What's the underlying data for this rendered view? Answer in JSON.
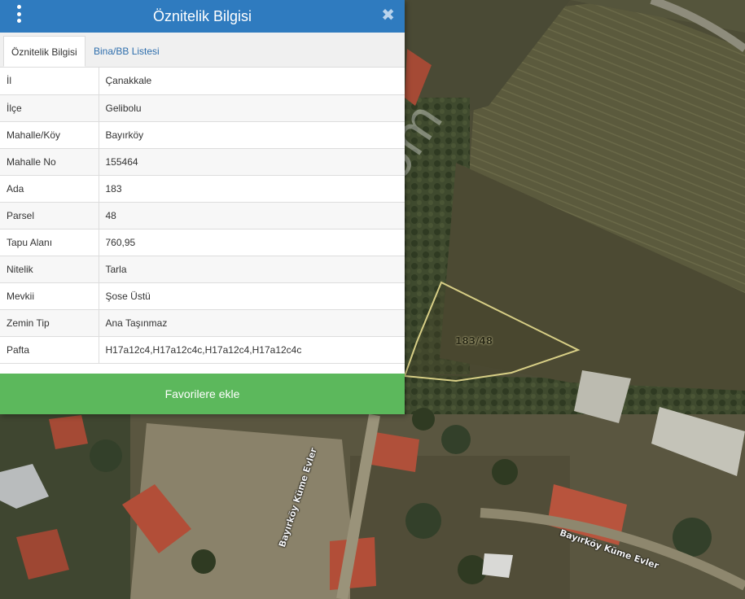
{
  "panel": {
    "title": "Öznitelik Bilgisi",
    "menu_icon": "vertical-dots-icon",
    "close_icon": "close-icon",
    "close_glyph": "✖",
    "tabs": [
      {
        "label": "Öznitelik Bilgisi",
        "active": true
      },
      {
        "label": "Bina/BB Listesi",
        "active": false
      }
    ],
    "rows": [
      {
        "key": "İl",
        "value": "Çanakkale"
      },
      {
        "key": "İlçe",
        "value": "Gelibolu"
      },
      {
        "key": "Mahalle/Köy",
        "value": "Bayırköy"
      },
      {
        "key": "Mahalle No",
        "value": "155464"
      },
      {
        "key": "Ada",
        "value": "183"
      },
      {
        "key": "Parsel",
        "value": "48"
      },
      {
        "key": "Tapu Alanı",
        "value": "760,95"
      },
      {
        "key": "Nitelik",
        "value": "Tarla"
      },
      {
        "key": "Mevkii",
        "value": "Şose Üstü"
      },
      {
        "key": "Zemin Tip",
        "value": "Ana Taşınmaz"
      },
      {
        "key": "Pafta",
        "value": "H17a12c4,H17a12c4c,H17a12c4,H17a12c4c"
      }
    ],
    "favorite_button": "Favorilere ekle",
    "header_color": "#2f7bbf",
    "button_color": "#5cb85c"
  },
  "map": {
    "parcel_label": "183/48",
    "parcel_outline_color": "#d8cf86",
    "street_labels": [
      "Bayırköy Küme Evler",
      "Bayırköy Küme Evler"
    ],
    "watermark": "emlakjet.com"
  }
}
